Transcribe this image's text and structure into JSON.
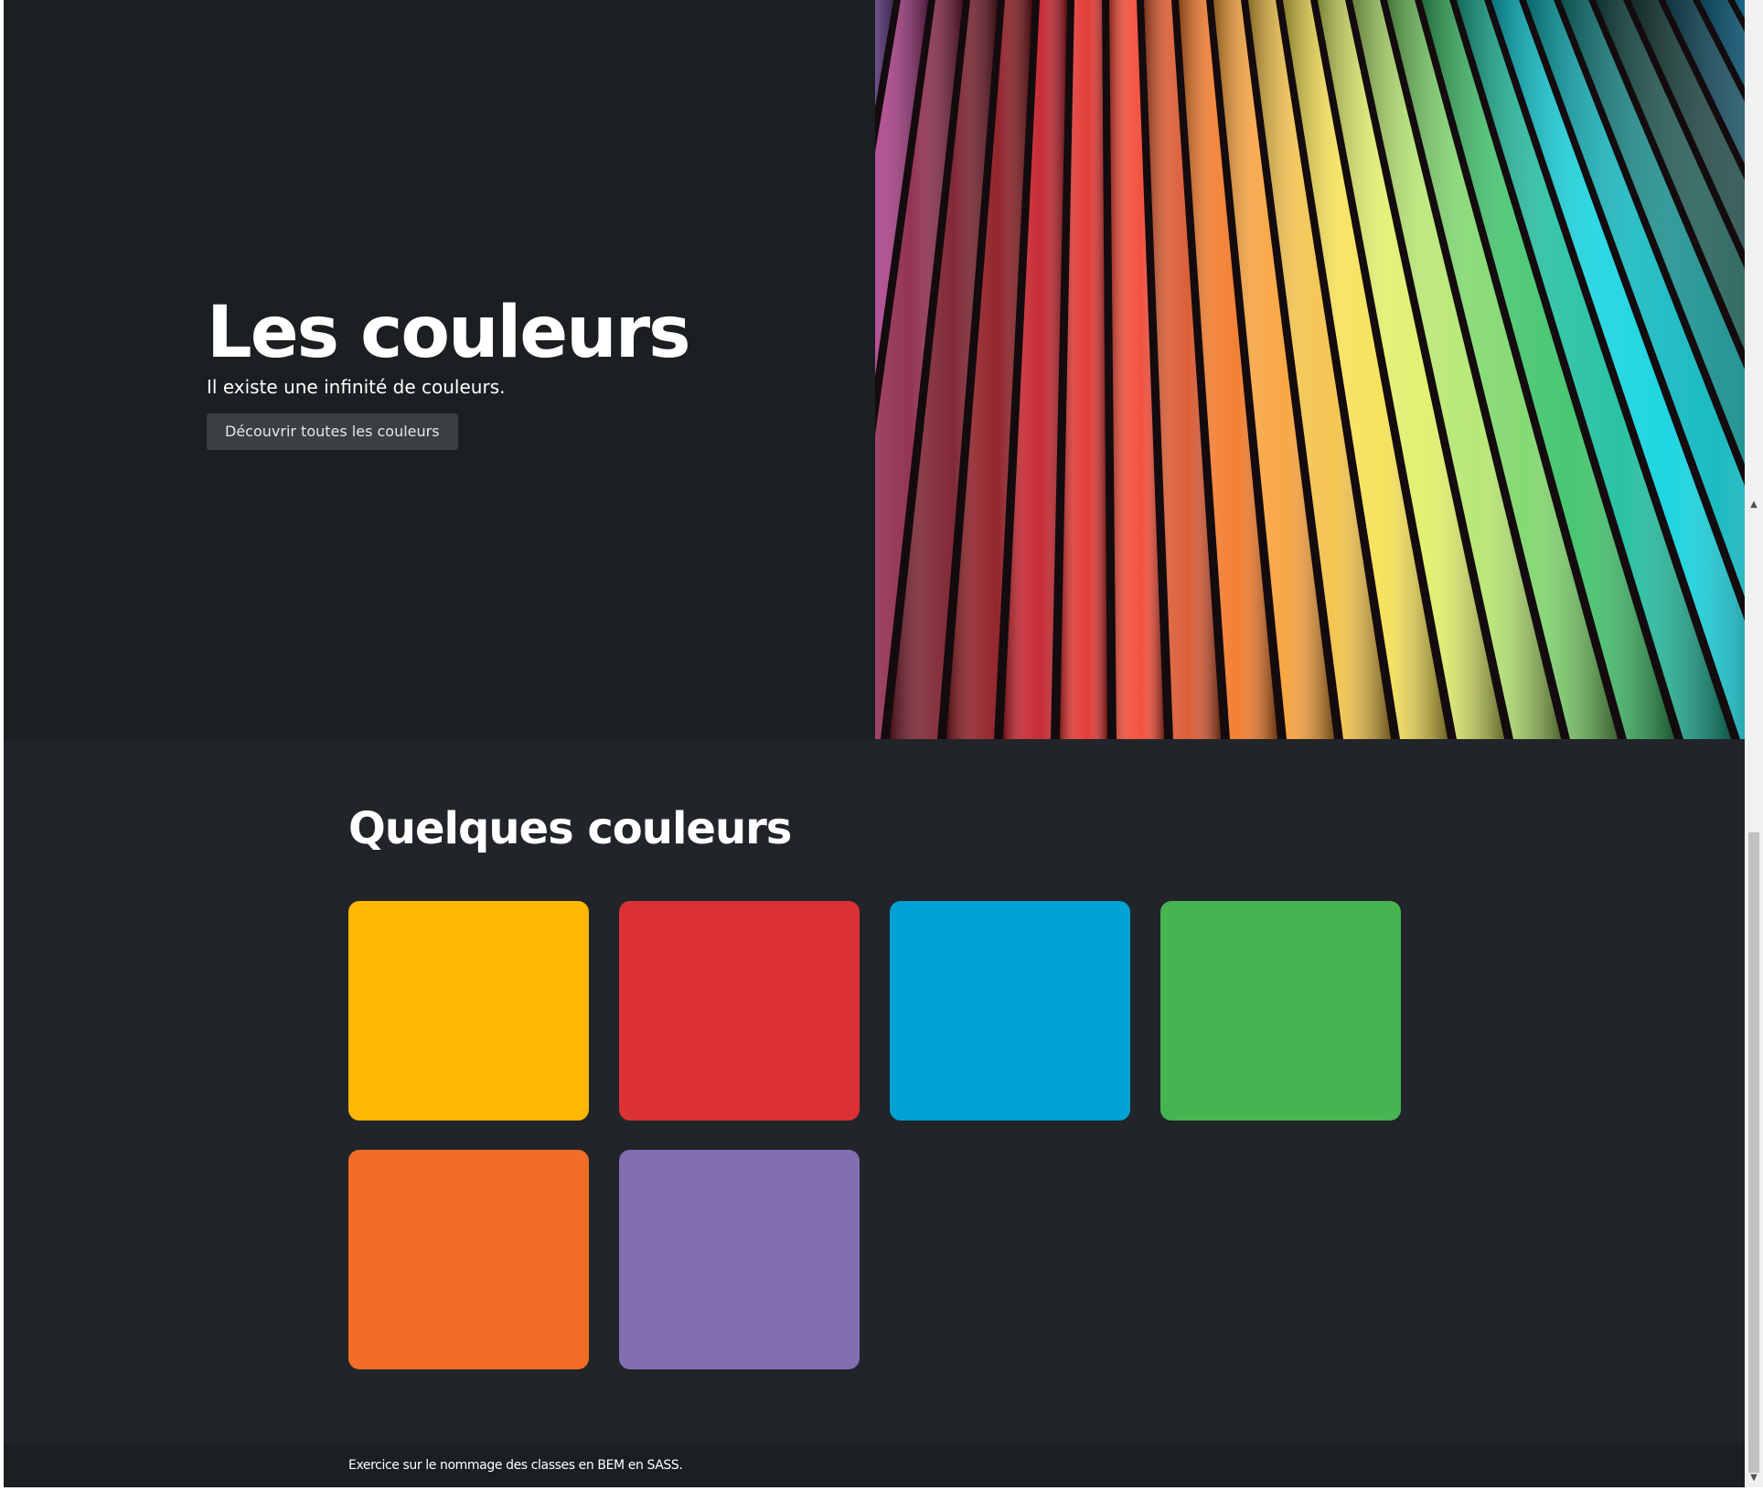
{
  "hero": {
    "title": "Les couleurs",
    "subtitle": "Il existe une infinité de couleurs.",
    "button_label": "Découvrir toutes les couleurs",
    "image_subject": "colored-pencils-photo"
  },
  "colors_section": {
    "title": "Quelques couleurs",
    "swatches": [
      {
        "color": "#ffb703"
      },
      {
        "color": "#dc3133"
      },
      {
        "color": "#00a1d3"
      },
      {
        "color": "#47b452"
      },
      {
        "color": "#f26e28"
      },
      {
        "color": "#836eb3"
      }
    ]
  },
  "footer": {
    "text": "Exercice sur le nommage des classes en BEM en SASS."
  },
  "theme": {
    "hero_bg": "#1b1f22",
    "section_bg": "#212529",
    "button_bg": "#3a3f44"
  },
  "scrollbar": {
    "up_arrow": "▲",
    "down_arrow": "▼"
  }
}
